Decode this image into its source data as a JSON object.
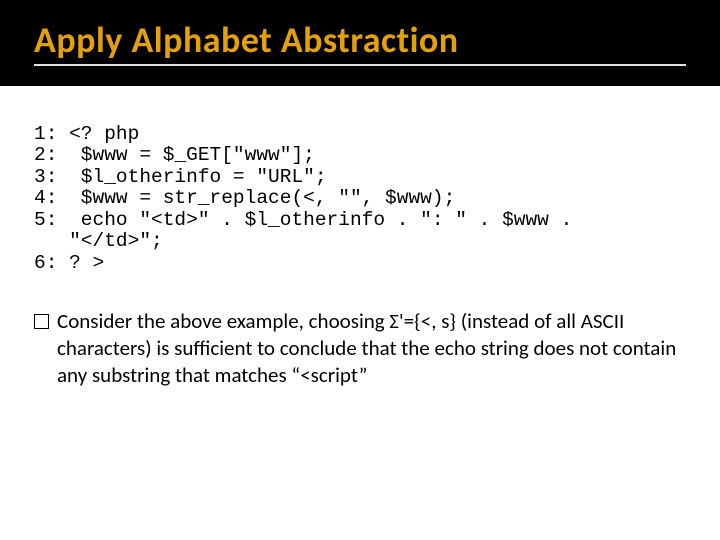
{
  "title": "Apply Alphabet Abstraction",
  "code": {
    "l1": "1: <? php",
    "l2": "2:  $www = $_GET[\"www\"];",
    "l3": "3:  $l_otherinfo = \"URL\";",
    "l4": "4:  $www = str_replace(<, \"\", $www);",
    "l5": "5:  echo \"<td>\" . $l_otherinfo . \": \" . $www .",
    "l5b": "   \"</td>\";",
    "l6": "6: ? >"
  },
  "body": "Consider the above example, choosing Σ'={<, s} (instead of all ASCII characters) is sufficient to conclude that the echo string does not contain any substring that matches “<script”"
}
